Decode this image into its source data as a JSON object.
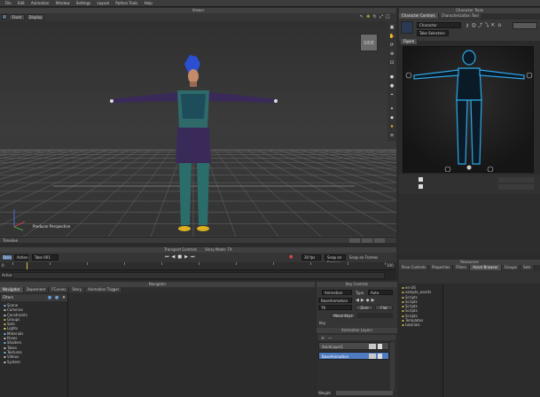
{
  "menu": [
    "File",
    "Edit",
    "Animation",
    "Window",
    "Settings",
    "Layout",
    "Python Tools",
    "Help"
  ],
  "viewer": {
    "title": "Viewer",
    "toolbar_left": [
      "Front",
      "Display"
    ],
    "cube_label": "SIDE",
    "camera_label": "Producer Perspective",
    "bottom_label": "Timeline"
  },
  "character_tools": {
    "title": "Character Tools",
    "tabs": [
      "Character Controls",
      "Characterization Tool"
    ],
    "character_field": "Character",
    "sub_field": "Take Selectors",
    "panel_tab": "Figure"
  },
  "transport": {
    "title": "Transport Controls",
    "subtitle": "Story Mode: TX",
    "mode": "Story",
    "action_label": "Action",
    "take": "Take 001",
    "fps": "30 fps",
    "snap": "Snap on Frames",
    "frame_left": "0",
    "frame_right": "100",
    "ruler_ticks": [
      "0",
      "10",
      "20",
      "30",
      "40",
      "50",
      "60",
      "70",
      "80",
      "90",
      "100"
    ],
    "action_row": "Action"
  },
  "navigator": {
    "title": "Navigator",
    "tabs": [
      "Navigator",
      "Dopesheet",
      "FCurves",
      "Story",
      "Animation Trigger"
    ],
    "root": "Filters",
    "tree": [
      "Scene",
      "Cameras",
      "Constraints",
      "Groups",
      "Sets",
      "Lights",
      "Materials",
      "Poses",
      "Shaders",
      "Takes",
      "Textures",
      "Videos",
      "System"
    ]
  },
  "key_controls": {
    "title": "Key Controls",
    "animation_dropdown": "Animation",
    "type_label": "Type",
    "type_value": "Auto",
    "base_dropdown": "BaseAnimation",
    "tr_dropdown": "TR",
    "buttons": [
      "Zero",
      "Flat"
    ],
    "move_keys": "Move Keys",
    "key_label": "Key",
    "layers_title": "Animation Layers",
    "layers": [
      "AnimLayer1",
      "BaseAnimation"
    ],
    "weight_label": "Weight"
  },
  "resources": {
    "title": "Resources",
    "tabs": [
      "Pose Controls",
      "Properties",
      "Filters",
      "Asset Browser",
      "Groups",
      "Sets"
    ],
    "active_tab": "Asset Browser",
    "tree": [
      "en-US",
      "sample_assets",
      "Scripts",
      "Scripts",
      "Scripts",
      "Scripts",
      "Scripts",
      "Templates",
      "tutorials"
    ]
  }
}
